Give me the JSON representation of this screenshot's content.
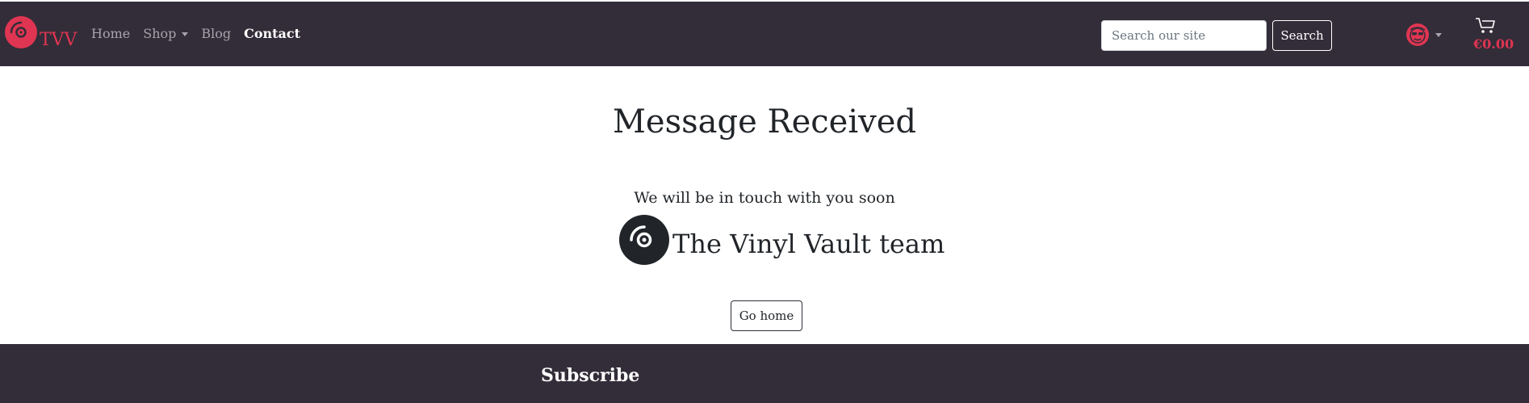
{
  "brand": {
    "name": "TVV",
    "logo_icon": "vinyl-record-icon",
    "accent_color": "#e03552"
  },
  "nav": {
    "items": [
      {
        "label": "Home",
        "active": false
      },
      {
        "label": "Shop",
        "active": false,
        "has_dropdown": true
      },
      {
        "label": "Blog",
        "active": false
      },
      {
        "label": "Contact",
        "active": true
      }
    ]
  },
  "search": {
    "placeholder": "Search our site",
    "value": "",
    "button_label": "Search"
  },
  "account": {
    "icon": "napster-style-avatar-icon"
  },
  "cart": {
    "icon": "shopping-cart-icon",
    "total": "€0.00"
  },
  "main": {
    "title": "Message Received",
    "message": "We will be in touch with you soon",
    "signature": "The Vinyl Vault team",
    "home_button_label": "Go home"
  },
  "footer": {
    "heading": "Subscribe"
  },
  "colors": {
    "navbar_bg": "#332d39",
    "accent": "#e03552",
    "nav_link": "#a7a3ad",
    "text": "#212529"
  }
}
